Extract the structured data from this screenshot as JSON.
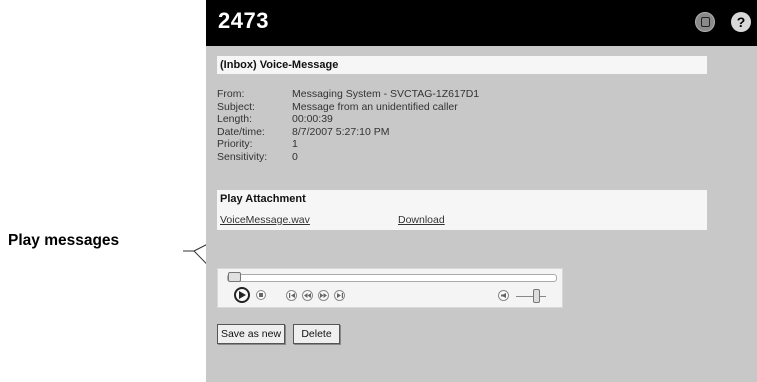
{
  "callout": {
    "label": "Play messages"
  },
  "header": {
    "title": "2473",
    "icons": [
      "message-icon",
      "help-icon"
    ],
    "help_glyph": "?"
  },
  "message": {
    "heading": "(Inbox) Voice-Message",
    "fields": [
      {
        "label": "From:",
        "value": "Messaging System - SVCTAG-1Z617D1"
      },
      {
        "label": "Subject:",
        "value": "Message from an unidentified caller"
      },
      {
        "label": "Length:",
        "value": "00:00:39"
      },
      {
        "label": "Date/time:",
        "value": "8/7/2007 5:27:10 PM"
      },
      {
        "label": "Priority:",
        "value": "1"
      },
      {
        "label": "Sensitivity:",
        "value": "0"
      }
    ]
  },
  "attachment": {
    "heading": "Play Attachment",
    "file_link": "VoiceMessage.wav",
    "download_link": "Download"
  },
  "player": {
    "position": 0.0,
    "volume": 0.55
  },
  "actions": {
    "save_as_new": "Save as new",
    "delete": "Delete"
  },
  "colors": {
    "topbar": "#000000",
    "panel": "#c8c8c8",
    "header_bg": "#f6f6f6"
  }
}
